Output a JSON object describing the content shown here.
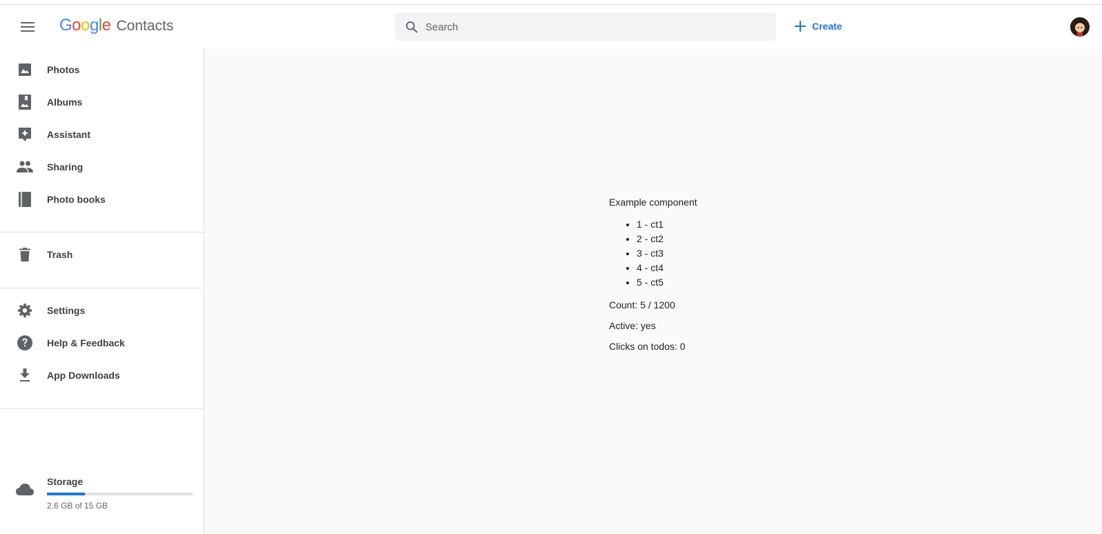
{
  "header": {
    "logo_google": [
      "G",
      "o",
      "o",
      "g",
      "l",
      "e"
    ],
    "logo_colors": [
      "#4285F4",
      "#EA4335",
      "#FBBC05",
      "#4285F4",
      "#34A853",
      "#EA4335"
    ],
    "product_name": "Contacts",
    "search_placeholder": "Search",
    "create_label": "Create"
  },
  "sidebar": {
    "items": [
      {
        "label": "Photos",
        "icon": "photo-icon"
      },
      {
        "label": "Albums",
        "icon": "album-icon"
      },
      {
        "label": "Assistant",
        "icon": "assistant-icon"
      },
      {
        "label": "Sharing",
        "icon": "people-icon"
      },
      {
        "label": "Photo books",
        "icon": "book-icon"
      },
      {
        "label": "Trash",
        "icon": "trash-icon"
      },
      {
        "label": "Settings",
        "icon": "gear-icon"
      },
      {
        "label": "Help & Feedback",
        "icon": "help-icon"
      },
      {
        "label": "App Downloads",
        "icon": "download-icon"
      }
    ],
    "storage": {
      "title": "Storage",
      "detail": "2.6 GB of 15 GB",
      "used_fraction": 0.26,
      "icon": "cloud-icon"
    }
  },
  "main": {
    "heading": "Example component",
    "todos": [
      "1 - ct1",
      "2 - ct2",
      "3 - ct3",
      "4 - ct4",
      "5 - ct5"
    ],
    "count": "Count: 5 / 1200",
    "active": "Active: yes",
    "clicks": "Clicks on todos: 0"
  },
  "colors": {
    "accent": "#1a73e8",
    "icon_gray": "#5f6368"
  }
}
